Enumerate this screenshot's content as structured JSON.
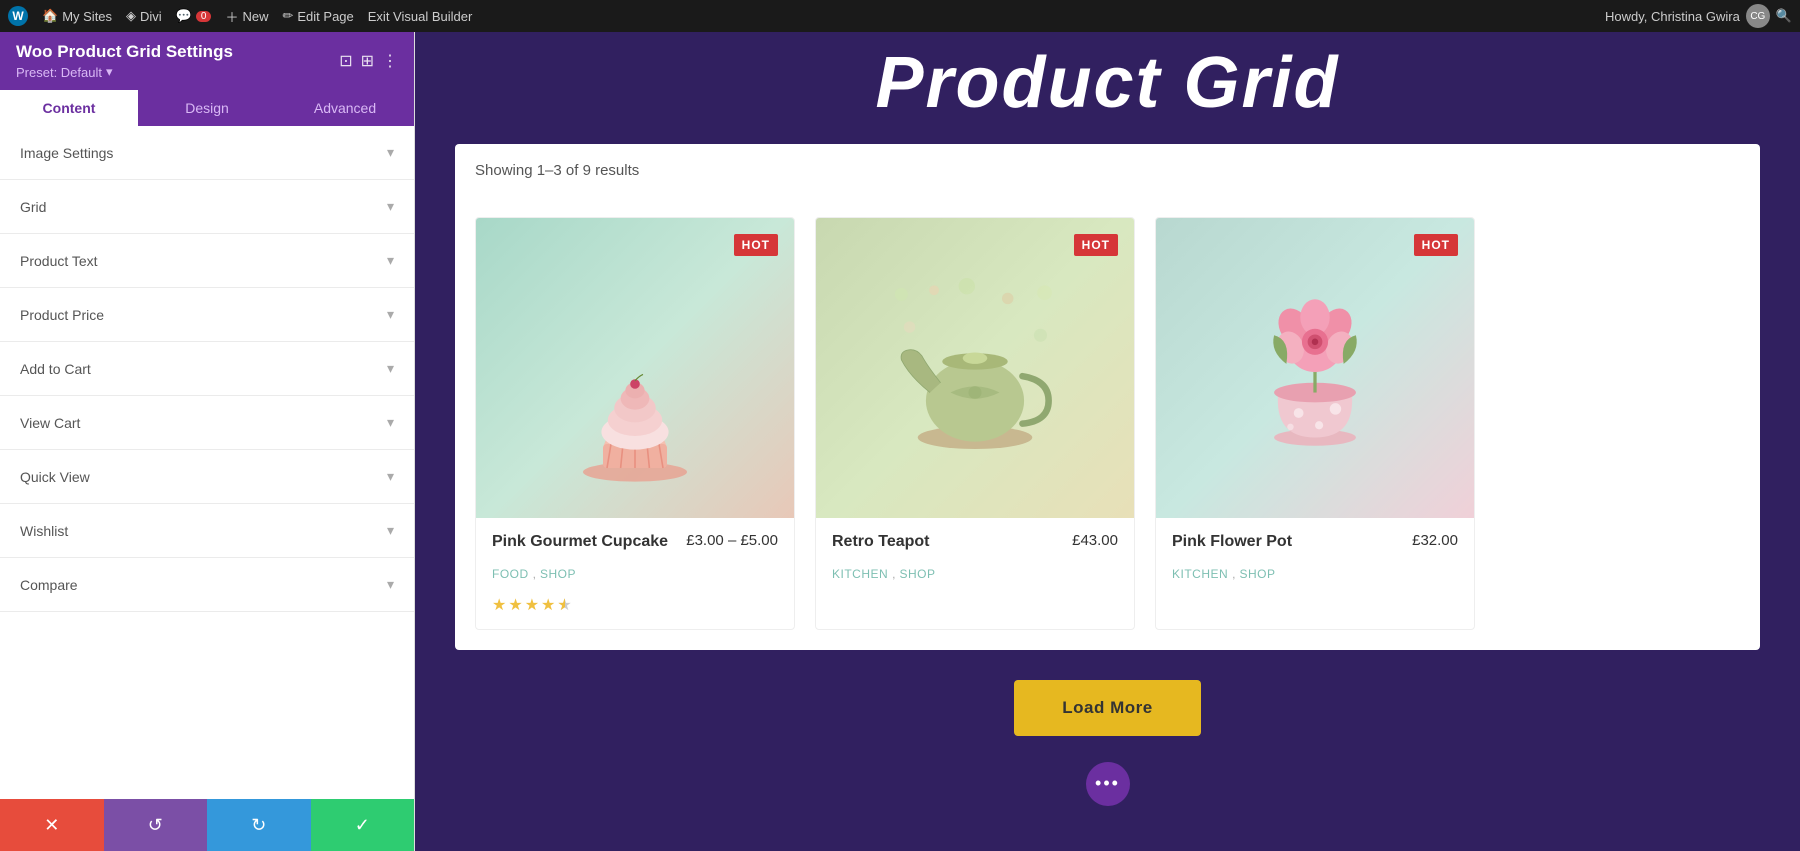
{
  "admin_bar": {
    "wp_label": "W",
    "my_sites_label": "My Sites",
    "divi_label": "Divi",
    "comment_count": "0",
    "new_label": "New",
    "edit_page_label": "Edit Page",
    "exit_builder_label": "Exit Visual Builder",
    "howdy_label": "Howdy, Christina Gwira"
  },
  "sidebar": {
    "title": "Woo Product Grid Settings",
    "preset_label": "Preset: Default",
    "tabs": [
      {
        "id": "content",
        "label": "Content",
        "active": true
      },
      {
        "id": "design",
        "label": "Design",
        "active": false
      },
      {
        "id": "advanced",
        "label": "Advanced",
        "active": false
      }
    ],
    "sections": [
      {
        "id": "image-settings",
        "label": "Image Settings"
      },
      {
        "id": "grid",
        "label": "Grid"
      },
      {
        "id": "product-text",
        "label": "Product Text"
      },
      {
        "id": "product-price",
        "label": "Product Price"
      },
      {
        "id": "add-to-cart",
        "label": "Add to Cart"
      },
      {
        "id": "view-cart",
        "label": "View Cart"
      },
      {
        "id": "quick-view",
        "label": "Quick View"
      },
      {
        "id": "wishlist",
        "label": "Wishlist"
      },
      {
        "id": "compare",
        "label": "Compare"
      }
    ],
    "footer_buttons": [
      {
        "id": "cancel",
        "icon": "✕",
        "color": "#e74c3c"
      },
      {
        "id": "undo",
        "icon": "↺",
        "color": "#7b4fa6"
      },
      {
        "id": "redo",
        "icon": "↻",
        "color": "#3498db"
      },
      {
        "id": "save",
        "icon": "✓",
        "color": "#2ecc71"
      }
    ]
  },
  "page": {
    "heading": "Product Grid",
    "results_text": "Showing 1–3 of 9 results",
    "load_more_label": "Load More",
    "dots_icon": "•••",
    "products": [
      {
        "id": "cupcake",
        "name": "Pink Gourmet Cupcake",
        "price": "£3.00 – £5.00",
        "categories": [
          "FOOD",
          "SHOP"
        ],
        "badge": "HOT",
        "stars": [
          1,
          1,
          1,
          1,
          0.5
        ],
        "image_type": "cupcake",
        "image_icon": "🧁"
      },
      {
        "id": "teapot",
        "name": "Retro Teapot",
        "price": "£43.00",
        "categories": [
          "KITCHEN",
          "SHOP"
        ],
        "badge": "HOT",
        "stars": [],
        "image_type": "teapot",
        "image_icon": "🫖"
      },
      {
        "id": "flower-pot",
        "name": "Pink Flower Pot",
        "price": "£32.00",
        "categories": [
          "KITCHEN",
          "SHOP"
        ],
        "badge": "HOT",
        "stars": [],
        "image_type": "flower",
        "image_icon": "🌸"
      }
    ]
  }
}
